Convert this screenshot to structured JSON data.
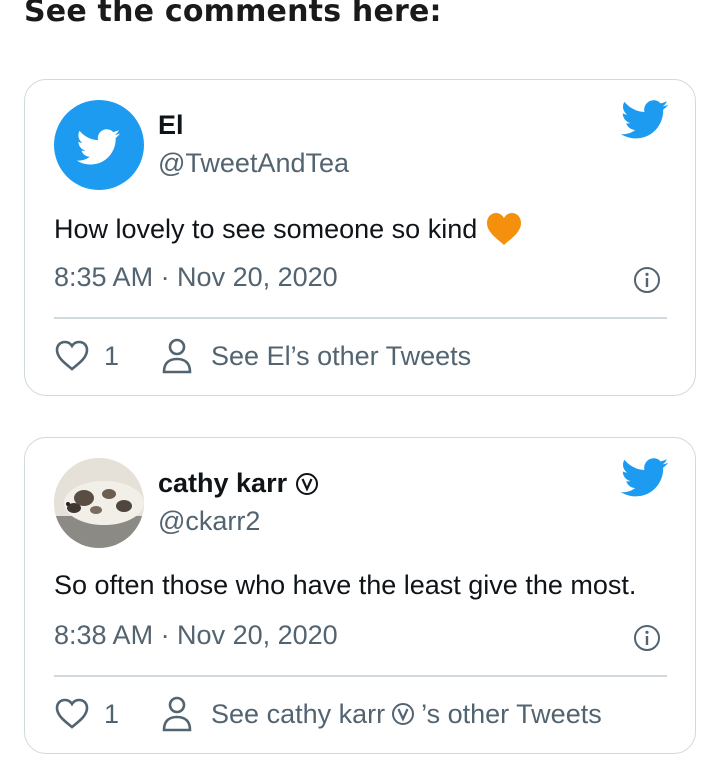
{
  "heading": "See the comments here:",
  "tweets": [
    {
      "name": "El",
      "handle": "@TweetAndTea",
      "text": "How lovely to see someone so kind",
      "timestamp": "8:35 AM · Nov 20, 2020",
      "likes": "1",
      "see_other_prefix": "See El’s other Tweets",
      "see_other_suffix": "",
      "verified": false,
      "avatar_icon": "twitter-bird-icon"
    },
    {
      "name": "cathy karr",
      "handle": "@ckarr2",
      "text": "So often those who have the least give the most.",
      "timestamp": "8:38 AM · Nov 20, 2020",
      "likes": "1",
      "see_other_prefix": "See cathy karr",
      "see_other_suffix": "’s other Tweets",
      "verified": true,
      "avatar_icon": "dog-photo"
    }
  ],
  "colors": {
    "twitter_blue": "#1d9bf0",
    "secondary_text": "#536471",
    "border": "#cfd9de",
    "orange_heart": "#f4900c"
  }
}
